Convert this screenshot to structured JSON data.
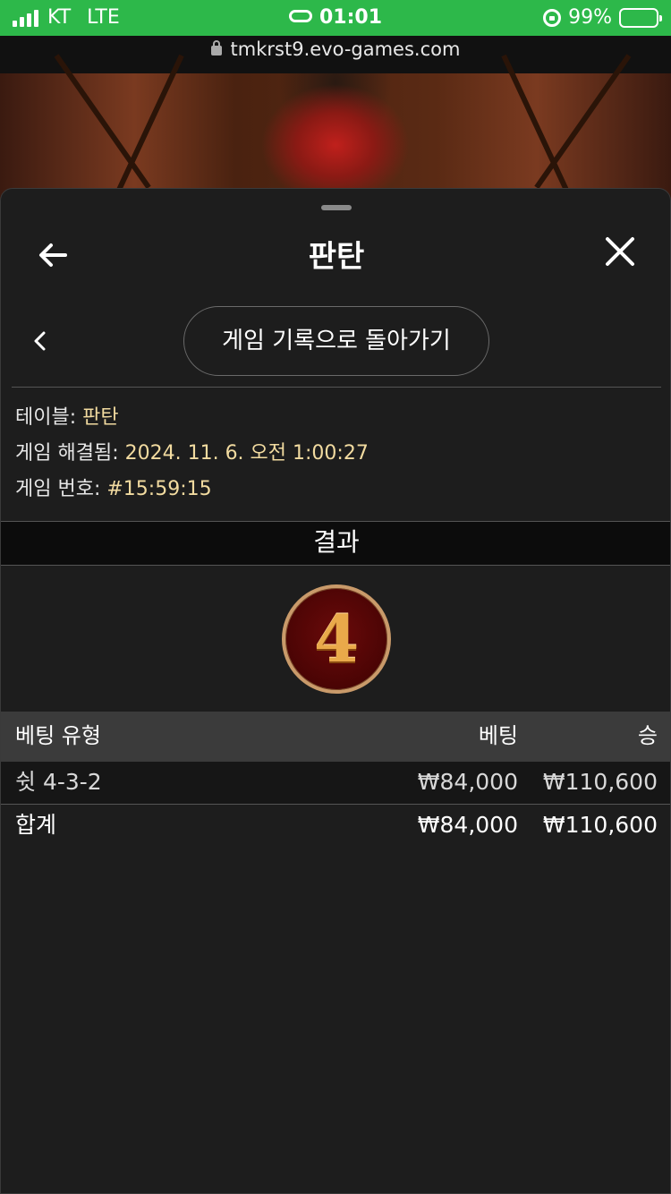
{
  "status_bar": {
    "carrier": "KT",
    "network": "LTE",
    "time": "01:01",
    "battery": "99%"
  },
  "url": "tmkrst9.evo-games.com",
  "header": {
    "title": "판탄"
  },
  "sub_nav": {
    "history_button_label": "게임 기록으로 돌아가기"
  },
  "info": {
    "table_label": "테이블:",
    "table_value": "판탄",
    "resolved_label": "게임 해결됨:",
    "resolved_value": "2024. 11. 6. 오전 1:00:27",
    "game_no_label": "게임 번호:",
    "game_no_value": "#15:59:15"
  },
  "result": {
    "heading": "결과",
    "number": "4"
  },
  "table": {
    "headers": [
      "베팅 유형",
      "베팅",
      "승"
    ],
    "rows": [
      [
        "쉿 4-3-2",
        "₩84,000",
        "₩110,600"
      ]
    ],
    "total": [
      "합계",
      "₩84,000",
      "₩110,600"
    ]
  },
  "colors": {
    "status_green": "#2db84a",
    "sheet_bg": "#1d1d1d",
    "info_value": "#f2dba0",
    "ball_ring": "#c99a6a",
    "ball_digit": "#e9a94a"
  }
}
